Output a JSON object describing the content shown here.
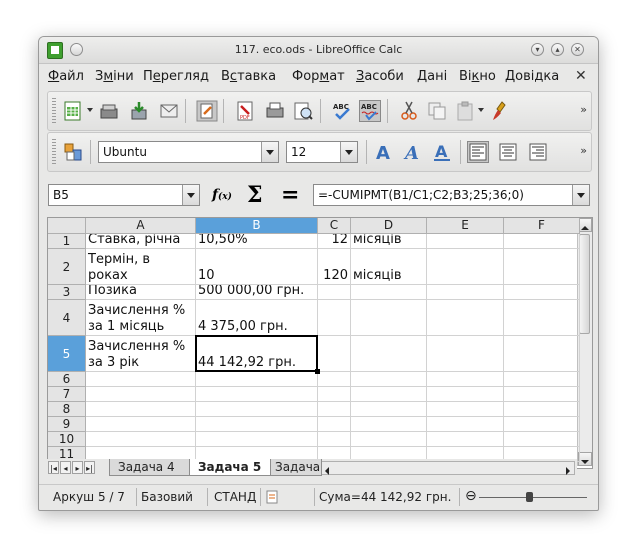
{
  "window": {
    "title": "117. eco.ods - LibreOffice Calc"
  },
  "menu": [
    {
      "pre": "",
      "u": "Ф",
      "post": "айл"
    },
    {
      "pre": "З",
      "u": "м",
      "post": "іни"
    },
    {
      "pre": "П",
      "u": "е",
      "post": "регляд"
    },
    {
      "pre": "В",
      "u": "с",
      "post": "тавка"
    },
    {
      "pre": "Фор",
      "u": "м",
      "post": "ат"
    },
    {
      "pre": "",
      "u": "З",
      "post": "асоби"
    },
    {
      "pre": "",
      "u": "Д",
      "post": "ані"
    },
    {
      "pre": "Ві",
      "u": "к",
      "post": "но"
    },
    {
      "pre": "",
      "u": "Д",
      "post": "овідка"
    }
  ],
  "formatting": {
    "font_name": "Ubuntu",
    "font_size": "12"
  },
  "formula": {
    "cell_ref": "B5",
    "content": "=-CUMIPMT(B1/C1;C2;B3;25;36;0)"
  },
  "columns": [
    "A",
    "B",
    "C",
    "D",
    "E",
    "F"
  ],
  "selected": {
    "col": "B",
    "row": "5"
  },
  "rows": [
    {
      "num": "1",
      "a": "Ставка, річна",
      "b": "10,50%",
      "c": "12",
      "d": "місяців"
    },
    {
      "num": "2",
      "a": "Термін, в роках",
      "b": "10",
      "c": "120",
      "d": "місяців"
    },
    {
      "num": "3",
      "a": "Позика",
      "b": "500 000,00 грн.",
      "c": "",
      "d": ""
    },
    {
      "num": "4",
      "a": "Зачислення % за 1 місяць",
      "b": "4 375,00 грн.",
      "c": "",
      "d": ""
    },
    {
      "num": "5",
      "a": "Зачислення % за 3 рік",
      "b": "44 142,92 грн.",
      "c": "",
      "d": ""
    },
    {
      "num": "6",
      "a": "",
      "b": "",
      "c": "",
      "d": ""
    },
    {
      "num": "7",
      "a": "",
      "b": "",
      "c": "",
      "d": ""
    },
    {
      "num": "8",
      "a": "",
      "b": "",
      "c": "",
      "d": ""
    },
    {
      "num": "9",
      "a": "",
      "b": "",
      "c": "",
      "d": ""
    },
    {
      "num": "10",
      "a": "",
      "b": "",
      "c": "",
      "d": ""
    },
    {
      "num": "11",
      "a": "",
      "b": "",
      "c": "",
      "d": ""
    }
  ],
  "sheets": [
    {
      "label": "Задача 4",
      "active": false
    },
    {
      "label": "Задача 5",
      "active": true
    },
    {
      "label": "Задача",
      "active": false
    }
  ],
  "status": {
    "sheet": "Аркуш 5 / 7",
    "style": "Базовий",
    "mode": "СТАНД",
    "sum": "Сума=44 142,92 грн."
  },
  "colors": {
    "selection": "#5aa0da",
    "green_icon": "#3f9f2f"
  }
}
